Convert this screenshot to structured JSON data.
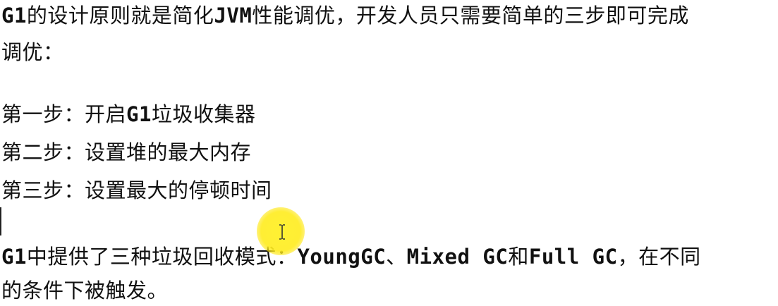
{
  "document": {
    "intro": {
      "line1_a": "G1",
      "line1_b": "的设计原则就是简化",
      "line1_c": "JVM",
      "line1_d": "性能调优，开发人员只需要简单的三步即可完成",
      "line2": "调优："
    },
    "steps": [
      {
        "a": "第一步：开启",
        "b": "G1",
        "c": "垃圾收集器"
      },
      {
        "a": "第二步：设置堆的最大内存"
      },
      {
        "a": "第三步：设置最大的停顿时间"
      }
    ],
    "modes": {
      "line1_a": "G1",
      "line1_b": "中提供了三种垃圾回收模式：",
      "line1_c": "YoungGC",
      "line1_d": "、",
      "line1_e": "Mixed GC",
      "line1_f": "和",
      "line1_g": "Full GC",
      "line1_h": "，在不同",
      "line2": "的条件下被触发。"
    }
  },
  "cursor": {
    "icon": "text-ibeam-cursor-icon",
    "highlight_color": "#FFEB1F"
  }
}
